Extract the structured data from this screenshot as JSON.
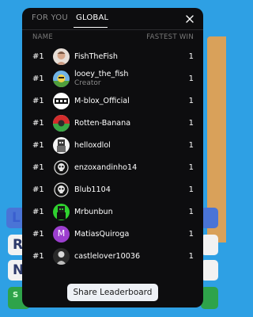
{
  "tabs": [
    "FOR YOU",
    "GLOBAL"
  ],
  "header": {
    "name": "NAME",
    "fastest_win": "FASTEST WIN"
  },
  "rows": [
    {
      "rank": "#1",
      "name": "FishTheFish",
      "wins": "1",
      "avatar": "face-photo-icon"
    },
    {
      "rank": "#1",
      "name": "looey_the_fish",
      "subtitle": "Creator",
      "wins": "1",
      "avatar": "fish-avatar-icon"
    },
    {
      "rank": "#1",
      "name": "M-blox_Official",
      "wins": "1",
      "avatar": "mblox-logo-icon"
    },
    {
      "rank": "#1",
      "name": "Rotten-Banana",
      "wins": "1",
      "avatar": "banana-avatar-icon"
    },
    {
      "rank": "#1",
      "name": "helloxdlol",
      "wins": "1",
      "avatar": "character-avatar-icon"
    },
    {
      "rank": "#1",
      "name": "enzoxandinho14",
      "wins": "1",
      "avatar": "skull-avatar-icon"
    },
    {
      "rank": "#1",
      "name": "Blub1104",
      "wins": "1",
      "avatar": "skull-avatar-icon"
    },
    {
      "rank": "#1",
      "name": "Mrbunbun",
      "wins": "1",
      "avatar": "green-character-icon"
    },
    {
      "rank": "#1",
      "name": "MatiasQuiroga",
      "wins": "1",
      "avatar": "letter-avatar-icon",
      "avatar_letter": "M",
      "avatar_color": "#9c3fcf"
    },
    {
      "rank": "#1",
      "name": "castlelover10036",
      "wins": "1",
      "avatar": "dark-avatar-icon"
    }
  ],
  "share_button": "Share Leaderboard",
  "background_letters": [
    "L",
    "R",
    "N",
    "S"
  ],
  "colors": {
    "background": "#2ea0e4",
    "modal": "#0d0d0f",
    "text": "#ffffff",
    "muted": "#7a7a7a"
  }
}
